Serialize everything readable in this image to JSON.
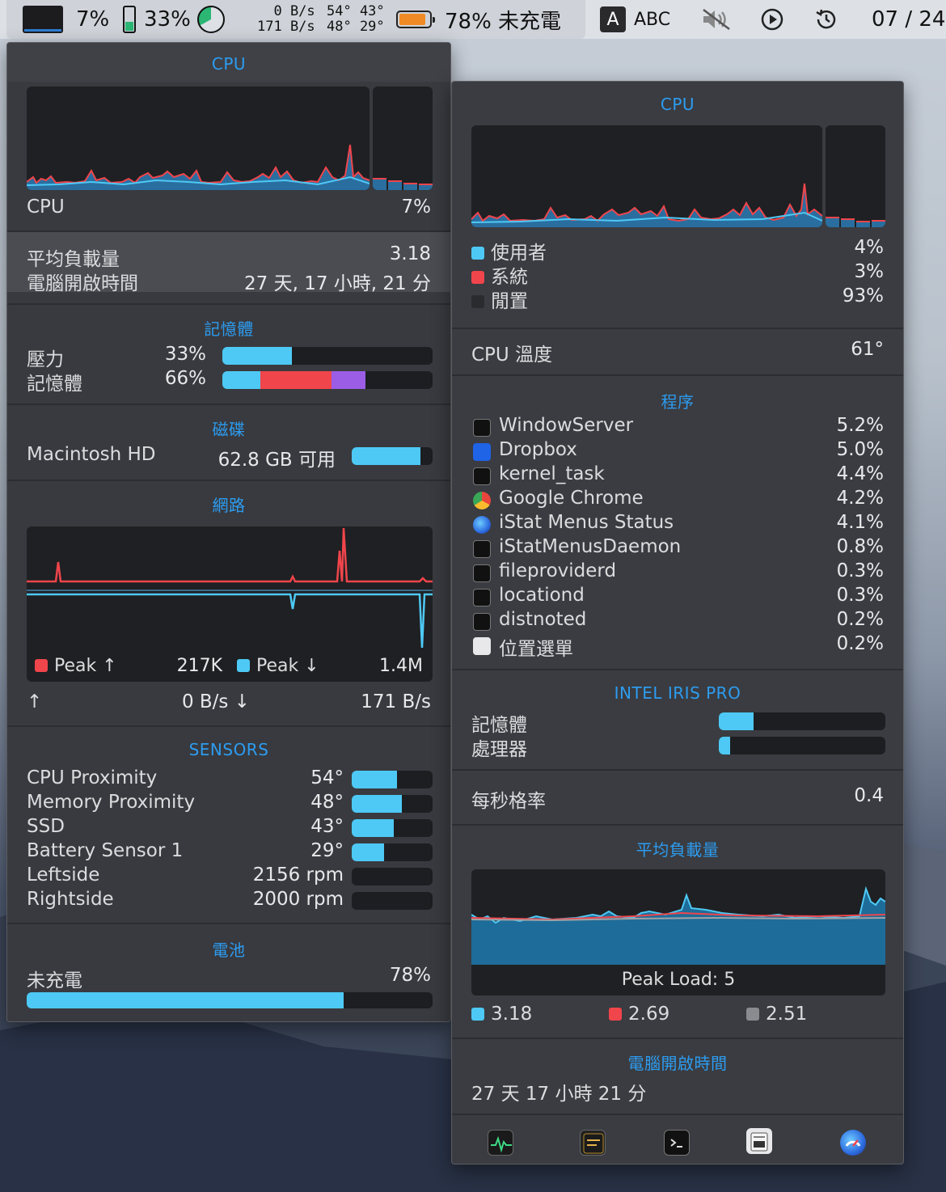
{
  "menubar": {
    "cpu_percent": "7%",
    "memory_percent": "33%",
    "net_up": "0 B/s",
    "net_down": "171 B/s",
    "temps_row1": "54° 43°",
    "temps_row2": "48° 29°",
    "battery_text": "78% 未充電",
    "ime_letter": "A",
    "ime_label": "ABC",
    "date": "07 / 24"
  },
  "left": {
    "cpu": {
      "title": "CPU",
      "label": "CPU",
      "value": "7%"
    },
    "load": {
      "avg_label": "平均負載量",
      "avg_value": "3.18",
      "uptime_label": "電腦開啟時間",
      "uptime_value": "27 天, 17 小時, 21 分"
    },
    "memory": {
      "title": "記憶體",
      "pressure_label": "壓力",
      "pressure_value": "33%",
      "pressure_fraction": 0.33,
      "memory_label": "記憶體",
      "memory_value": "66%",
      "segments": [
        0.18,
        0.34,
        0.16
      ],
      "segment_colors": [
        "#4ec9f5",
        "#f0454b",
        "#9b5de5"
      ]
    },
    "disk": {
      "title": "磁碟",
      "name": "Macintosh HD",
      "free": "62.8 GB 可用",
      "fraction": 0.85
    },
    "network": {
      "title": "網路",
      "peak_up_label": "Peak ↑",
      "peak_up_value": "217K",
      "peak_down_label": "Peak ↓",
      "peak_down_value": "1.4M",
      "up_arrow": "↑",
      "up_value": "0 B/s ↓",
      "down_value": "171 B/s"
    },
    "sensors": {
      "title": "SENSORS",
      "items": [
        {
          "label": "CPU Proximity",
          "value": "54°",
          "fraction": 0.56
        },
        {
          "label": "Memory Proximity",
          "value": "48°",
          "fraction": 0.62
        },
        {
          "label": "SSD",
          "value": "43°",
          "fraction": 0.52
        },
        {
          "label": "Battery Sensor 1",
          "value": "29°",
          "fraction": 0.4
        },
        {
          "label": "Leftside",
          "value": "2156 rpm",
          "fraction": 0
        },
        {
          "label": "Rightside",
          "value": "2000 rpm",
          "fraction": 0
        }
      ]
    },
    "battery": {
      "title": "電池",
      "status": "未充電",
      "value": "78%",
      "fraction": 0.78
    }
  },
  "right": {
    "cpu": {
      "title": "CPU",
      "legend": [
        {
          "label": "使用者",
          "value": "4%",
          "color": "#4ec9f5"
        },
        {
          "label": "系統",
          "value": "3%",
          "color": "#f0454b"
        },
        {
          "label": "閒置",
          "value": "93%",
          "color": "#2a2b2e"
        }
      ],
      "temp_label": "CPU 溫度",
      "temp_value": "61°"
    },
    "processes": {
      "title": "程序",
      "items": [
        {
          "name": "WindowServer",
          "value": "5.2%",
          "icon": "terminal-icon"
        },
        {
          "name": "Dropbox",
          "value": "5.0%",
          "icon": "dropbox-icon"
        },
        {
          "name": "kernel_task",
          "value": "4.4%",
          "icon": "terminal-icon"
        },
        {
          "name": "Google Chrome",
          "value": "4.2%",
          "icon": "chrome-icon"
        },
        {
          "name": "iStat Menus Status",
          "value": "4.1%",
          "icon": "istat-icon"
        },
        {
          "name": "iStatMenusDaemon",
          "value": "0.8%",
          "icon": "terminal-icon"
        },
        {
          "name": "fileproviderd",
          "value": "0.3%",
          "icon": "terminal-icon"
        },
        {
          "name": "locationd",
          "value": "0.3%",
          "icon": "terminal-icon"
        },
        {
          "name": "distnoted",
          "value": "0.2%",
          "icon": "terminal-icon"
        },
        {
          "name": "位置選單",
          "value": "0.2%",
          "icon": "location-menu-icon"
        }
      ]
    },
    "gpu": {
      "title": "INTEL IRIS PRO",
      "memory_label": "記憶體",
      "memory_fraction": 0.21,
      "processor_label": "處理器",
      "processor_fraction": 0.07
    },
    "fps": {
      "label": "每秒格率",
      "value": "0.4"
    },
    "load": {
      "title": "平均負載量",
      "peak": "Peak Load: 5",
      "values": [
        {
          "value": "3.18",
          "color": "#4ec9f5"
        },
        {
          "value": "2.69",
          "color": "#f0454b"
        },
        {
          "value": "2.51",
          "color": "#8a8b8f"
        }
      ]
    },
    "uptime": {
      "title": "電腦開啟時間",
      "value": "27 天 17 小時 21 分"
    },
    "dock": [
      "activity-monitor-icon",
      "console-icon",
      "terminal-icon",
      "system-info-icon",
      "istat-icon"
    ]
  }
}
